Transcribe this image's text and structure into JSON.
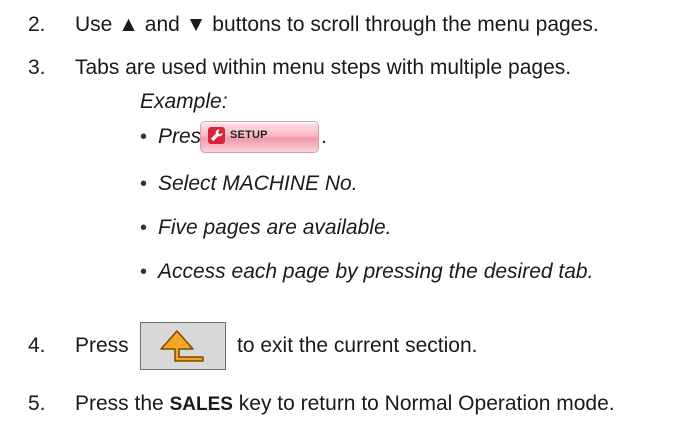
{
  "steps": [
    {
      "number": "2.",
      "text": "Use ▲ and ▼ buttons to scroll through the menu pages."
    },
    {
      "number": "3.",
      "text": "Tabs are used within menu steps with multiple pages."
    },
    {
      "number": "4.",
      "text_before": "Press",
      "text_after": "to exit the current section."
    },
    {
      "number": "5.",
      "text_before": "Press the",
      "key": "SALES",
      "text_after": "key to return to Normal Operation mode."
    }
  ],
  "example": {
    "label": "Example:",
    "press_label": "Press",
    "press_suffix": ".",
    "bullets": [
      "Select MACHINE No.",
      "Five pages are available.",
      "Access each page by pressing the desired tab."
    ]
  },
  "setup_button": {
    "label": "SETUP",
    "icon": "wrench-icon",
    "color": "#d9233e"
  },
  "back_button": {
    "icon": "return-arrow-icon",
    "color": "#f5a623"
  }
}
